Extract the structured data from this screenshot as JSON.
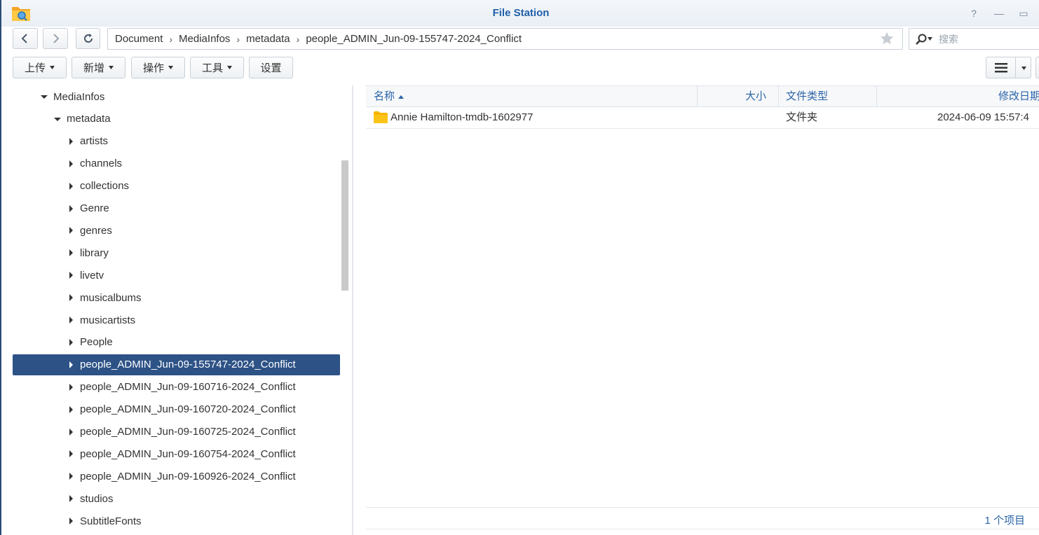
{
  "window": {
    "title": "File Station"
  },
  "titlebar": {
    "help_glyph": "?",
    "minimize_glyph": "—",
    "maximize_glyph": "▭"
  },
  "breadcrumb": [
    "Document",
    "MediaInfos",
    "metadata",
    "people_ADMIN_Jun-09-155747-2024_Conflict"
  ],
  "search": {
    "placeholder": "搜索"
  },
  "toolbar": {
    "upload_label": "上传",
    "new_label": "新增",
    "action_label": "操作",
    "tools_label": "工具",
    "settings_label": "设置"
  },
  "tree": [
    {
      "label": "MediaInfos",
      "expanded": true,
      "level": 1
    },
    {
      "label": "metadata",
      "expanded": true,
      "level": 2
    },
    {
      "label": "artists",
      "expanded": false,
      "level": 3
    },
    {
      "label": "channels",
      "expanded": false,
      "level": 3
    },
    {
      "label": "collections",
      "expanded": false,
      "level": 3
    },
    {
      "label": "Genre",
      "expanded": false,
      "level": 3
    },
    {
      "label": "genres",
      "expanded": false,
      "level": 3
    },
    {
      "label": "library",
      "expanded": false,
      "level": 3
    },
    {
      "label": "livetv",
      "expanded": false,
      "level": 3
    },
    {
      "label": "musicalbums",
      "expanded": false,
      "level": 3
    },
    {
      "label": "musicartists",
      "expanded": false,
      "level": 3
    },
    {
      "label": "People",
      "expanded": false,
      "level": 3
    },
    {
      "label": "people_ADMIN_Jun-09-155747-2024_Conflict",
      "expanded": false,
      "level": 3,
      "selected": true
    },
    {
      "label": "people_ADMIN_Jun-09-160716-2024_Conflict",
      "expanded": false,
      "level": 3
    },
    {
      "label": "people_ADMIN_Jun-09-160720-2024_Conflict",
      "expanded": false,
      "level": 3
    },
    {
      "label": "people_ADMIN_Jun-09-160725-2024_Conflict",
      "expanded": false,
      "level": 3
    },
    {
      "label": "people_ADMIN_Jun-09-160754-2024_Conflict",
      "expanded": false,
      "level": 3
    },
    {
      "label": "people_ADMIN_Jun-09-160926-2024_Conflict",
      "expanded": false,
      "level": 3
    },
    {
      "label": "studios",
      "expanded": false,
      "level": 3
    },
    {
      "label": "SubtitleFonts",
      "expanded": false,
      "level": 3
    }
  ],
  "list": {
    "columns": {
      "name": "名称",
      "size": "大小",
      "type": "文件类型",
      "modified": "修改日期"
    },
    "rows": [
      {
        "name": "Annie Hamilton-tmdb-1602977",
        "size": "",
        "type": "文件夹",
        "modified": "2024-06-09 15:57:4"
      }
    ],
    "item_count": "1 个项目"
  },
  "colors": {
    "accent": "#1f5fa8",
    "selected_bg": "#2d5286",
    "folder": "#f7b500"
  }
}
